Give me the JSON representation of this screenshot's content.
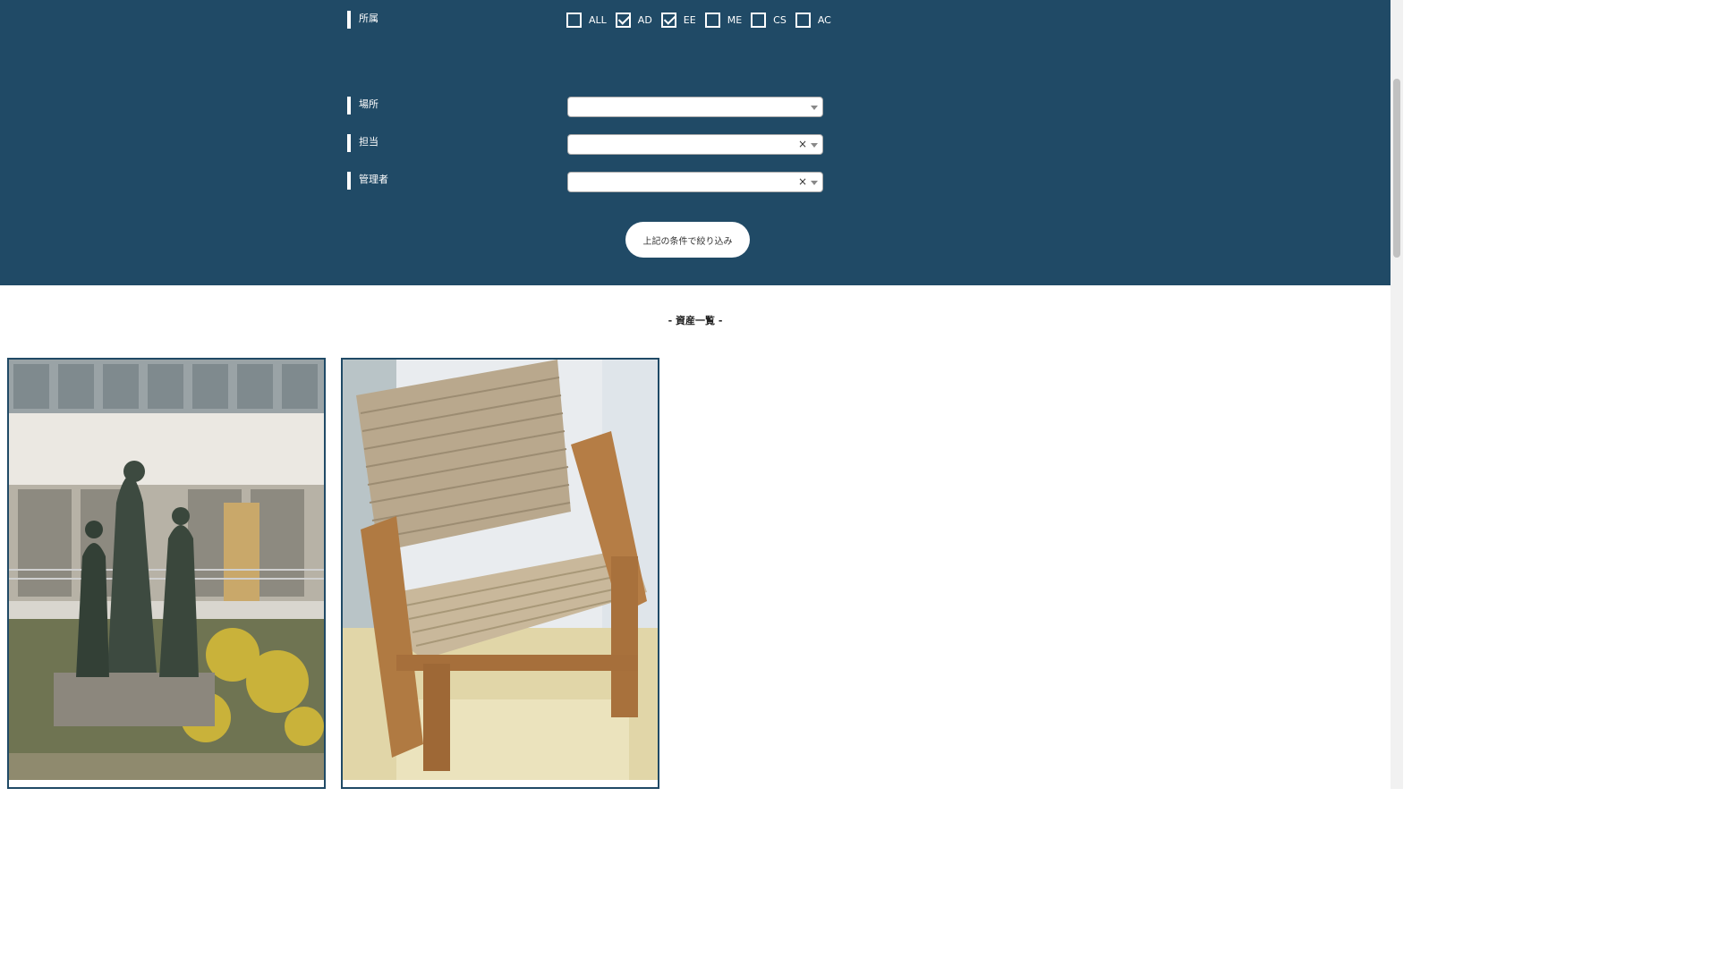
{
  "filters": {
    "affiliation": {
      "label": "所属",
      "options": [
        {
          "label": "ALL",
          "checked": false
        },
        {
          "label": "AD",
          "checked": true
        },
        {
          "label": "EE",
          "checked": true
        },
        {
          "label": "ME",
          "checked": false
        },
        {
          "label": "CS",
          "checked": false
        },
        {
          "label": "AC",
          "checked": false
        }
      ]
    },
    "location": {
      "label": "場所",
      "value": ""
    },
    "person_in_charge": {
      "label": "担当",
      "value": "",
      "clear": "×"
    },
    "manager": {
      "label": "管理者",
      "value": "",
      "clear": "×"
    },
    "submit_label": "上記の条件で絞り込み"
  },
  "asset_list": {
    "title": "- 資産一覧 -",
    "items": [
      {
        "image": "statue-photo"
      },
      {
        "image": "woven-chair-photo"
      }
    ]
  },
  "colors": {
    "panel_bg": "#204a66",
    "page_bg": "#ffffff"
  }
}
